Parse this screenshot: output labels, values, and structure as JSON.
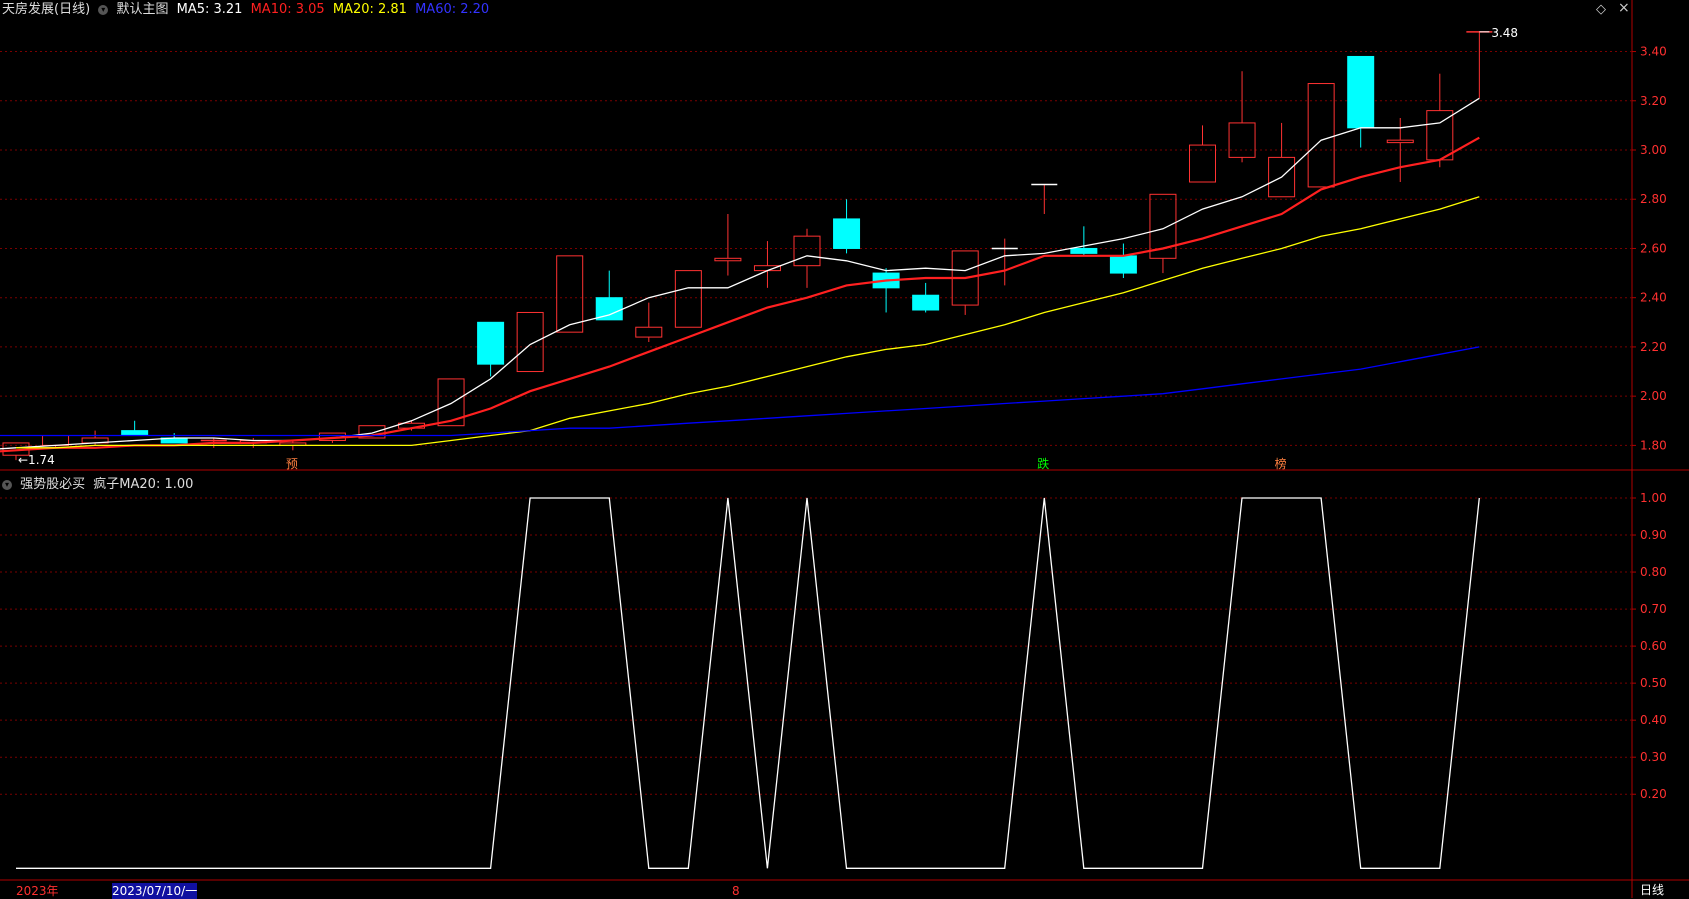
{
  "header": {
    "title": "天房发展(日线)",
    "main_chart_label": "默认主图",
    "ma5": "MA5: 3.21",
    "ma10": "MA10: 3.05",
    "ma20": "MA20: 2.81",
    "ma60": "MA60: 2.20",
    "diamond": "◇",
    "indicator_label": "强势股必买",
    "indicator_value": "疯子MA20: 1.00"
  },
  "footer": {
    "year": "2023年",
    "date": "2023/07/10/一",
    "month": "8",
    "period_button": "日线"
  },
  "colors": {
    "up": "#ff3232",
    "down": "#00ffff",
    "ma5": "#ffffff",
    "ma10": "#ff2020",
    "ma20": "#ffff00",
    "ma60": "#0000ff",
    "grid": "#7a0000",
    "axis": "#b00000"
  },
  "chart_data": [
    {
      "type": "candlestick",
      "title": "天房发展(日线)",
      "y_ticks": [
        "3.40",
        "3.20",
        "3.00",
        "2.80",
        "2.60",
        "2.40",
        "2.20",
        "2.00",
        "1.80"
      ],
      "ylim": [
        1.7,
        3.52
      ],
      "max_label": "3.48",
      "min_label": "1.74",
      "markers": [
        "预",
        "跌",
        "榜"
      ],
      "candles": [
        {
          "o": 1.76,
          "h": 1.81,
          "l": 1.74,
          "c": 1.81
        },
        {
          "o": 1.8,
          "h": 1.84,
          "l": 1.79,
          "c": 1.84
        },
        {
          "o": 1.81,
          "h": 1.86,
          "l": 1.8,
          "c": 1.83
        },
        {
          "o": 1.86,
          "h": 1.9,
          "l": 1.84,
          "c": 1.84
        },
        {
          "o": 1.83,
          "h": 1.85,
          "l": 1.81,
          "c": 1.81
        },
        {
          "o": 1.82,
          "h": 1.83,
          "l": 1.79,
          "c": 1.82
        },
        {
          "o": 1.81,
          "h": 1.83,
          "l": 1.79,
          "c": 1.82
        },
        {
          "o": 1.8,
          "h": 1.82,
          "l": 1.78,
          "c": 1.81
        },
        {
          "o": 1.82,
          "h": 1.85,
          "l": 1.81,
          "c": 1.85
        },
        {
          "o": 1.83,
          "h": 1.88,
          "l": 1.83,
          "c": 1.88
        },
        {
          "o": 1.87,
          "h": 1.9,
          "l": 1.86,
          "c": 1.89
        },
        {
          "o": 1.88,
          "h": 2.07,
          "l": 1.88,
          "c": 2.07
        },
        {
          "o": 2.3,
          "h": 2.3,
          "l": 2.08,
          "c": 2.13
        },
        {
          "o": 2.1,
          "h": 2.34,
          "l": 2.1,
          "c": 2.34
        },
        {
          "o": 2.26,
          "h": 2.57,
          "l": 2.26,
          "c": 2.57
        },
        {
          "o": 2.4,
          "h": 2.51,
          "l": 2.31,
          "c": 2.31
        },
        {
          "o": 2.24,
          "h": 2.38,
          "l": 2.22,
          "c": 2.28
        },
        {
          "o": 2.28,
          "h": 2.51,
          "l": 2.28,
          "c": 2.51
        },
        {
          "o": 2.55,
          "h": 2.74,
          "l": 2.49,
          "c": 2.56
        },
        {
          "o": 2.51,
          "h": 2.63,
          "l": 2.44,
          "c": 2.53
        },
        {
          "o": 2.53,
          "h": 2.68,
          "l": 2.44,
          "c": 2.65
        },
        {
          "o": 2.72,
          "h": 2.8,
          "l": 2.58,
          "c": 2.6
        },
        {
          "o": 2.5,
          "h": 2.52,
          "l": 2.34,
          "c": 2.44
        },
        {
          "o": 2.41,
          "h": 2.46,
          "l": 2.34,
          "c": 2.35
        },
        {
          "o": 2.37,
          "h": 2.59,
          "l": 2.33,
          "c": 2.59
        },
        {
          "o": 2.6,
          "h": 2.64,
          "l": 2.45,
          "c": 2.6
        },
        {
          "o": 2.86,
          "h": 2.86,
          "l": 2.74,
          "c": 2.86
        },
        {
          "o": 2.6,
          "h": 2.69,
          "l": 2.57,
          "c": 2.58
        },
        {
          "o": 2.57,
          "h": 2.62,
          "l": 2.48,
          "c": 2.5
        },
        {
          "o": 2.56,
          "h": 2.82,
          "l": 2.5,
          "c": 2.82
        },
        {
          "o": 2.87,
          "h": 3.1,
          "l": 2.87,
          "c": 3.02
        },
        {
          "o": 2.97,
          "h": 3.32,
          "l": 2.95,
          "c": 3.11
        },
        {
          "o": 2.81,
          "h": 3.11,
          "l": 2.81,
          "c": 2.97
        },
        {
          "o": 2.85,
          "h": 3.27,
          "l": 2.85,
          "c": 3.27
        },
        {
          "o": 3.38,
          "h": 3.38,
          "l": 3.01,
          "c": 3.09
        },
        {
          "o": 3.03,
          "h": 3.13,
          "l": 2.87,
          "c": 3.04
        },
        {
          "o": 2.96,
          "h": 3.31,
          "l": 2.93,
          "c": 3.16
        },
        {
          "o": 3.48,
          "h": 3.48,
          "l": 3.21,
          "c": 3.48
        }
      ],
      "series": [
        {
          "name": "MA5",
          "values": [
            1.78,
            1.79,
            1.8,
            1.81,
            1.82,
            1.83,
            1.83,
            1.82,
            1.82,
            1.83,
            1.85,
            1.9,
            1.97,
            2.07,
            2.21,
            2.29,
            2.33,
            2.4,
            2.44,
            2.44,
            2.51,
            2.57,
            2.55,
            2.51,
            2.52,
            2.51,
            2.57,
            2.58,
            2.61,
            2.64,
            2.68,
            2.76,
            2.81,
            2.89,
            3.04,
            3.09,
            3.09,
            3.11,
            3.21
          ]
        },
        {
          "name": "MA10",
          "values": [
            1.76,
            1.77,
            1.78,
            1.79,
            1.79,
            1.8,
            1.8,
            1.81,
            1.81,
            1.82,
            1.83,
            1.84,
            1.87,
            1.9,
            1.95,
            2.02,
            2.07,
            2.12,
            2.18,
            2.24,
            2.3,
            2.36,
            2.4,
            2.45,
            2.47,
            2.48,
            2.48,
            2.51,
            2.57,
            2.57,
            2.57,
            2.6,
            2.64,
            2.69,
            2.74,
            2.84,
            2.89,
            2.93,
            2.96,
            3.05
          ]
        },
        {
          "name": "MA20",
          "values": [
            1.79,
            1.79,
            1.8,
            1.8,
            1.8,
            1.8,
            1.8,
            1.8,
            1.8,
            1.8,
            1.8,
            1.82,
            1.84,
            1.86,
            1.91,
            1.94,
            1.97,
            2.01,
            2.04,
            2.08,
            2.12,
            2.16,
            2.19,
            2.21,
            2.25,
            2.29,
            2.34,
            2.38,
            2.42,
            2.47,
            2.52,
            2.56,
            2.6,
            2.65,
            2.68,
            2.72,
            2.76,
            2.81
          ]
        },
        {
          "name": "MA60",
          "values": [
            1.84,
            1.84,
            1.84,
            1.84,
            1.84,
            1.84,
            1.84,
            1.84,
            1.84,
            1.84,
            1.84,
            1.84,
            1.84,
            1.85,
            1.86,
            1.87,
            1.87,
            1.88,
            1.89,
            1.9,
            1.91,
            1.92,
            1.93,
            1.94,
            1.95,
            1.96,
            1.97,
            1.98,
            1.99,
            2.0,
            2.01,
            2.03,
            2.05,
            2.07,
            2.09,
            2.11,
            2.14,
            2.17,
            2.2
          ]
        }
      ]
    },
    {
      "type": "line",
      "title": "强势股必买",
      "y_ticks": [
        "1.00",
        "0.90",
        "0.80",
        "0.70",
        "0.60",
        "0.50",
        "0.40",
        "0.30",
        "0.20"
      ],
      "ylim": [
        -0.01,
        1.0
      ],
      "series": [
        {
          "name": "疯子MA20",
          "values": [
            0,
            0,
            0,
            0,
            0,
            0,
            0,
            0,
            0,
            0,
            0,
            0,
            0,
            1,
            1,
            1,
            0,
            0,
            1,
            0,
            1,
            0,
            0,
            0,
            0,
            0,
            1,
            0,
            0,
            0,
            0,
            1,
            1,
            1,
            0,
            0,
            0,
            1
          ]
        }
      ]
    }
  ]
}
